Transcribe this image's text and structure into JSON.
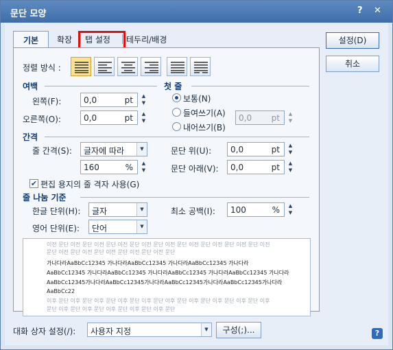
{
  "window": {
    "title": "문단 모양",
    "help_glyph": "?",
    "close_glyph": "✕"
  },
  "tabs": [
    {
      "label": "기본"
    },
    {
      "label": "확장"
    },
    {
      "label": "탭 설정"
    },
    {
      "label": "테두리/배경"
    }
  ],
  "alignment": {
    "label": "정렬 방식 :",
    "selected": "양쪽 정렬"
  },
  "margins": {
    "section": "여백",
    "left_label": "왼쪽(F):",
    "left_value": "0,0",
    "left_unit": "pt",
    "right_label": "오른쪽(O):",
    "right_value": "0,0",
    "right_unit": "pt"
  },
  "first_line": {
    "section": "첫 줄",
    "options": [
      "보통(N)",
      "들여쓰기(A)",
      "내어쓰기(B)"
    ],
    "selected": "보통(N)",
    "value": "0,0",
    "unit": "pt"
  },
  "spacing": {
    "section": "간격",
    "line_label": "줄 간격(S):",
    "line_mode": "글자에 따라",
    "line_value": "160",
    "line_unit": "%",
    "above_label": "문단 위(U):",
    "above_value": "0,0",
    "above_unit": "pt",
    "below_label": "문단 아래(V):",
    "below_value": "0,0",
    "below_unit": "pt",
    "grid_label": "편집 용지의 줄 격자 사용(G)",
    "grid_checked": true
  },
  "line_break": {
    "section": "줄 나눔 기준",
    "hangul_label": "한글 단위(H):",
    "hangul_value": "글자",
    "english_label": "영어 단위(E):",
    "english_value": "단어",
    "min_space_label": "최소 공백(I):",
    "min_space_value": "100",
    "min_space_unit": "%"
  },
  "preview": {
    "prev_lines": [
      "이전 문단 이전 문단 이전 문단 이전 문단 이전 문단 이전 문단 이전 문단 이전 문단 이전 문단 이전",
      "문단 이전 문단 이전 문단 이전 문단 이전 문단 이전 문단"
    ],
    "sample_lines": [
      "가나다라AaBbCc12345      가나다라AaBbCc12345      가나다라AaBbCc12345      가나다라",
      "AaBbCc12345 가나다라AaBbCc12345 가나다라AaBbCc12345 가나다라AaBbCc12345 가나다라",
      "AaBbCc12345가나다라AaBbCc12345가나다라AaBbCc12345가나다라AaBbCc12345가나다라",
      "AaBbCc22"
    ],
    "next_lines": [
      "이후 문단 이후 문단 이후 문단 이후 문단 이후 문단 이후 문단 이후 문단 이후 문단 이후 문단 이후",
      "문단 이후 문단 이후 문단 이후 문단 이후 문단 이후 문단"
    ]
  },
  "footer": {
    "dialog_setting_label": "대화 상자 설정(/):",
    "dialog_setting_value": "사용자 지정",
    "compose_label": "구성(;)...",
    "help_glyph": "?"
  },
  "buttons": {
    "ok": "설정(D)",
    "cancel": "취소"
  }
}
